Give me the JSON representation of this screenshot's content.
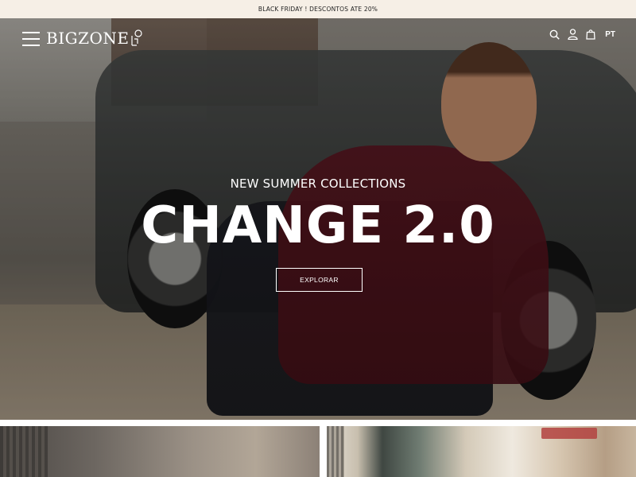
{
  "announcement": {
    "text": "BLACK FRIDAY !  DESCONTOS ATE 20%"
  },
  "header": {
    "menu_icon": "hamburger-menu-icon",
    "logo": {
      "text": "BIGZONE"
    },
    "icons": [
      "search-icon",
      "user-icon",
      "shopping-bag-icon"
    ],
    "language": "PT"
  },
  "hero": {
    "subtitle": "NEW SUMMER COLLECTIONS",
    "headline": "CHANGE 2.0",
    "cta_label": "EXPLORAR"
  },
  "colors": {
    "announcement_bg": "#f6efe6",
    "hero_text": "#ffffff",
    "sweater": "#5e1520"
  }
}
